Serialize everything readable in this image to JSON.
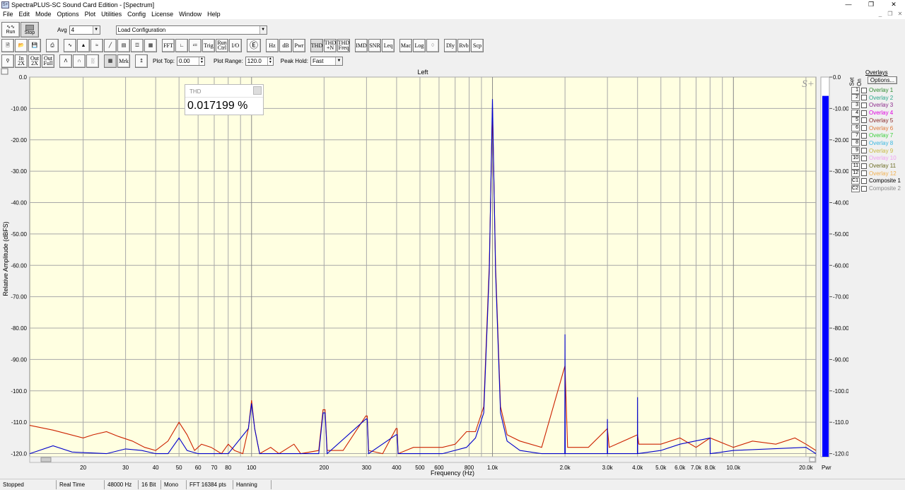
{
  "window": {
    "title": "SpectraPLUS-SC Sound Card Edition - [Spectrum]",
    "icon_text": "S+"
  },
  "menu": [
    "File",
    "Edit",
    "Mode",
    "Options",
    "Plot",
    "Utilities",
    "Config",
    "License",
    "Window",
    "Help"
  ],
  "toolbar1": {
    "run_label": "Run",
    "stop_label": "Stop",
    "avg_label": "Avg",
    "avg_value": "4",
    "config_value": "Load Configuration"
  },
  "toolbar2": {
    "fft": "FFT",
    "trig": "Trig",
    "run_ctrl": "Run Ctrl",
    "io": "I/O",
    "hz": "Hz",
    "db": "dB",
    "pwr": "Pwr",
    "thd": "THD",
    "thdn": "THD +N",
    "thd_freq": "THD Freq",
    "imd": "IMD",
    "snr": "SNR",
    "leq": "Leq",
    "mac": "Mac",
    "log": "Log",
    "dly": "Dly",
    "rvb": "Rvb",
    "scp": "Scp"
  },
  "toolbar3": {
    "in_2x": "In 2X",
    "out_2x": "Out 2X",
    "out_full": "Out Full",
    "mrk": "Mrk",
    "plot_top_label": "Plot Top:",
    "plot_top_value": "0.00",
    "plot_range_label": "Plot Range:",
    "plot_range_value": "120.0",
    "peak_hold_label": "Peak Hold:",
    "peak_hold_value": "Fast"
  },
  "plot": {
    "channel_title": "Left",
    "y_axis_label": "Relative Amplitude (dBFS)",
    "x_axis_label": "Frequency (Hz)",
    "watermark": "S+",
    "meter_label": "Pwr",
    "meter_level_db": -6.0
  },
  "thd_window": {
    "title": "THD",
    "value": "0.017199 %"
  },
  "overlays": {
    "header": "Overlays",
    "set_label": "Set",
    "on_label": "On",
    "options_label": "Options...",
    "items": [
      {
        "num": "1",
        "name": "Overlay 1",
        "color": "#2f8b2f"
      },
      {
        "num": "2",
        "name": "Overlay 2",
        "color": "#2aa88a"
      },
      {
        "num": "3",
        "name": "Overlay 3",
        "color": "#8b2a8b"
      },
      {
        "num": "4",
        "name": "Overlay 4",
        "color": "#e000e0"
      },
      {
        "num": "5",
        "name": "Overlay 5",
        "color": "#8a2a2a"
      },
      {
        "num": "6",
        "name": "Overlay 6",
        "color": "#e07a3a"
      },
      {
        "num": "7",
        "name": "Overlay 7",
        "color": "#3ad03a"
      },
      {
        "num": "8",
        "name": "Overlay 8",
        "color": "#3ab8e0"
      },
      {
        "num": "9",
        "name": "Overlay 9",
        "color": "#c8b840"
      },
      {
        "num": "10",
        "name": "Overlay 10",
        "color": "#f0a0f0"
      },
      {
        "num": "11",
        "name": "Overlay 11",
        "color": "#6a6a20"
      },
      {
        "num": "12",
        "name": "Overlay 12",
        "color": "#f0b050"
      },
      {
        "num": "C1",
        "name": "Composite 1",
        "color": "#000000"
      },
      {
        "num": "C2",
        "name": "Composite 2",
        "color": "#888888"
      }
    ]
  },
  "status": [
    "Stopped",
    "Real Time",
    "48000 Hz",
    "16 Bit",
    "Mono",
    "FFT 16384 pts",
    "Hanning"
  ],
  "colors": {
    "plot_bg": "#ffffe1",
    "trace_blue": "#0000cc",
    "trace_red": "#cc2200",
    "meter": "#0000ff"
  },
  "chart_data": {
    "type": "line",
    "y_ticks": [
      "0.0",
      "-10.00",
      "-20.00",
      "-30.00",
      "-40.00",
      "-50.00",
      "-60.00",
      "-70.00",
      "-80.00",
      "-90.00",
      "-100.0",
      "-110.0",
      "-120.0"
    ],
    "y_values": [
      0,
      -10,
      -20,
      -30,
      -40,
      -50,
      -60,
      -70,
      -80,
      -90,
      -100,
      -110,
      -120
    ],
    "x_ticks": [
      {
        "f": 20,
        "t": "20"
      },
      {
        "f": 30,
        "t": "30"
      },
      {
        "f": 40,
        "t": "40"
      },
      {
        "f": 50,
        "t": "50"
      },
      {
        "f": 60,
        "t": "60"
      },
      {
        "f": 70,
        "t": "70"
      },
      {
        "f": 80,
        "t": "80"
      },
      {
        "f": 100,
        "t": "100"
      },
      {
        "f": 200,
        "t": "200"
      },
      {
        "f": 300,
        "t": "300"
      },
      {
        "f": 400,
        "t": "400"
      },
      {
        "f": 500,
        "t": "500"
      },
      {
        "f": 600,
        "t": "600"
      },
      {
        "f": 800,
        "t": "800"
      },
      {
        "f": 1000,
        "t": "1.0k"
      },
      {
        "f": 2000,
        "t": "2.0k"
      },
      {
        "f": 3000,
        "t": "3.0k"
      },
      {
        "f": 4000,
        "t": "4.0k"
      },
      {
        "f": 5000,
        "t": "5.0k"
      },
      {
        "f": 6000,
        "t": "6.0k"
      },
      {
        "f": 7000,
        "t": "7.0k"
      },
      {
        "f": 8000,
        "t": "8.0k"
      },
      {
        "f": 10000,
        "t": "10.0k"
      },
      {
        "f": 20000,
        "t": "20.0k"
      }
    ],
    "x_range": [
      12,
      22000
    ],
    "y_range": [
      -121,
      0
    ],
    "x_scale": "log",
    "grid": true,
    "meter_ticks": [
      "0.0",
      "-10.00",
      "-20.00",
      "-30.00",
      "-40.00",
      "-50.00",
      "-60.00",
      "-70.00",
      "-80.00",
      "-90.00",
      "-100.0",
      "-110.0",
      "-120.0"
    ],
    "series": [
      {
        "color": "#cc2200",
        "points": [
          [
            12,
            -111
          ],
          [
            15,
            -112.5
          ],
          [
            20,
            -115
          ],
          [
            22,
            -114
          ],
          [
            25,
            -113
          ],
          [
            28,
            -114.5
          ],
          [
            32,
            -116
          ],
          [
            36,
            -118
          ],
          [
            40,
            -119
          ],
          [
            45,
            -116
          ],
          [
            50,
            -110
          ],
          [
            54,
            -114
          ],
          [
            58,
            -119
          ],
          [
            62,
            -117
          ],
          [
            68,
            -118
          ],
          [
            75,
            -120
          ],
          [
            80,
            -117
          ],
          [
            85,
            -119
          ],
          [
            92,
            -120
          ],
          [
            97,
            -112
          ],
          [
            100,
            -103
          ],
          [
            103,
            -112
          ],
          [
            108,
            -120
          ],
          [
            120,
            -118
          ],
          [
            130,
            -120
          ],
          [
            150,
            -117
          ],
          [
            160,
            -120
          ],
          [
            190,
            -119
          ],
          [
            198,
            -106
          ],
          [
            202,
            -106
          ],
          [
            206,
            -119
          ],
          [
            240,
            -119
          ],
          [
            298,
            -108
          ],
          [
            302,
            -108
          ],
          [
            306,
            -119
          ],
          [
            350,
            -120
          ],
          [
            398,
            -112
          ],
          [
            402,
            -112
          ],
          [
            406,
            -120
          ],
          [
            470,
            -118
          ],
          [
            550,
            -118
          ],
          [
            620,
            -118
          ],
          [
            700,
            -117
          ],
          [
            780,
            -113
          ],
          [
            850,
            -113
          ],
          [
            920,
            -105
          ],
          [
            970,
            -60
          ],
          [
            1000,
            -10
          ],
          [
            1030,
            -60
          ],
          [
            1080,
            -105
          ],
          [
            1150,
            -114
          ],
          [
            1300,
            -116
          ],
          [
            1600,
            -118
          ],
          [
            2000,
            -92
          ],
          [
            2050,
            -118
          ],
          [
            2500,
            -118
          ],
          [
            3000,
            -112
          ],
          [
            3050,
            -118
          ],
          [
            4000,
            -114
          ],
          [
            4050,
            -117
          ],
          [
            5000,
            -117
          ],
          [
            6000,
            -115
          ],
          [
            7000,
            -118
          ],
          [
            8000,
            -115
          ],
          [
            10000,
            -118
          ],
          [
            12000,
            -116
          ],
          [
            15000,
            -117
          ],
          [
            18000,
            -115
          ],
          [
            20000,
            -117
          ],
          [
            22000,
            -119
          ]
        ]
      },
      {
        "color": "#0000cc",
        "points": [
          [
            12,
            -120
          ],
          [
            15,
            -117.5
          ],
          [
            18,
            -119.5
          ],
          [
            25,
            -120
          ],
          [
            30,
            -118.5
          ],
          [
            35,
            -119
          ],
          [
            40,
            -120
          ],
          [
            45,
            -120
          ],
          [
            50,
            -115
          ],
          [
            54,
            -119
          ],
          [
            60,
            -120
          ],
          [
            80,
            -120
          ],
          [
            97,
            -112
          ],
          [
            100,
            -104
          ],
          [
            103,
            -112
          ],
          [
            108,
            -120
          ],
          [
            190,
            -120
          ],
          [
            198,
            -107
          ],
          [
            202,
            -107
          ],
          [
            206,
            -120
          ],
          [
            298,
            -109
          ],
          [
            302,
            -109
          ],
          [
            306,
            -120
          ],
          [
            398,
            -114
          ],
          [
            402,
            -114
          ],
          [
            406,
            -120
          ],
          [
            620,
            -120
          ],
          [
            780,
            -118
          ],
          [
            850,
            -115
          ],
          [
            920,
            -107
          ],
          [
            970,
            -62
          ],
          [
            1000,
            -7
          ],
          [
            1030,
            -62
          ],
          [
            1080,
            -107
          ],
          [
            1150,
            -116
          ],
          [
            1300,
            -119
          ],
          [
            1600,
            -120
          ],
          [
            1995,
            -120
          ],
          [
            2000,
            -82
          ],
          [
            2005,
            -120
          ],
          [
            2995,
            -120
          ],
          [
            3000,
            -109
          ],
          [
            3005,
            -120
          ],
          [
            3995,
            -120
          ],
          [
            4000,
            -102
          ],
          [
            4005,
            -120
          ],
          [
            5000,
            -119
          ],
          [
            6000,
            -117
          ],
          [
            8000,
            -115
          ],
          [
            8010,
            -120
          ],
          [
            10000,
            -119
          ],
          [
            20000,
            -118
          ],
          [
            22000,
            -120
          ]
        ]
      }
    ]
  }
}
